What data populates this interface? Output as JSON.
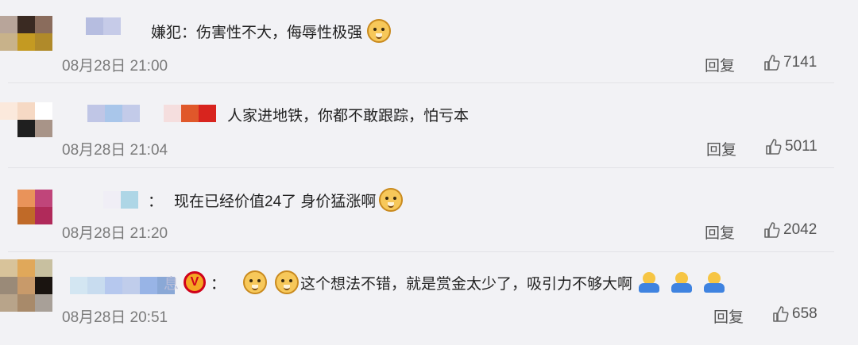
{
  "comments": [
    {
      "text": "嫌犯：伤害性不大，侮辱性极强",
      "emoji_suffix": [
        "dog-icon"
      ],
      "time": "08月28日 21:00",
      "reply": "回复",
      "likes": "7141"
    },
    {
      "text": "人家进地铁，你都不敢跟踪，怕亏本",
      "emoji_suffix": [],
      "time": "08月28日 21:04",
      "reply": "回复",
      "likes": "5011"
    },
    {
      "prefix": "：",
      "text": "现在已经价值24了 身价猛涨啊",
      "emoji_suffix": [
        "dog-icon"
      ],
      "time": "08月28日 21:20",
      "reply": "回复",
      "likes": "2042"
    },
    {
      "name_tail": "息",
      "prefix": "：",
      "text": "这个想法不错，就是赏金太少了，吸引力不够大啊",
      "emoji_prefix": [
        "dog-icon",
        "dog-icon"
      ],
      "emoji_suffix": [
        "shrug-icon",
        "shrug-icon",
        "shrug-icon"
      ],
      "time": "08月28日 20:51",
      "reply": "回复",
      "likes": "658",
      "verified_badge": "V"
    }
  ],
  "colors": {
    "background": "#f2f2f5",
    "text": "#222222",
    "meta": "#7a7a7a"
  }
}
